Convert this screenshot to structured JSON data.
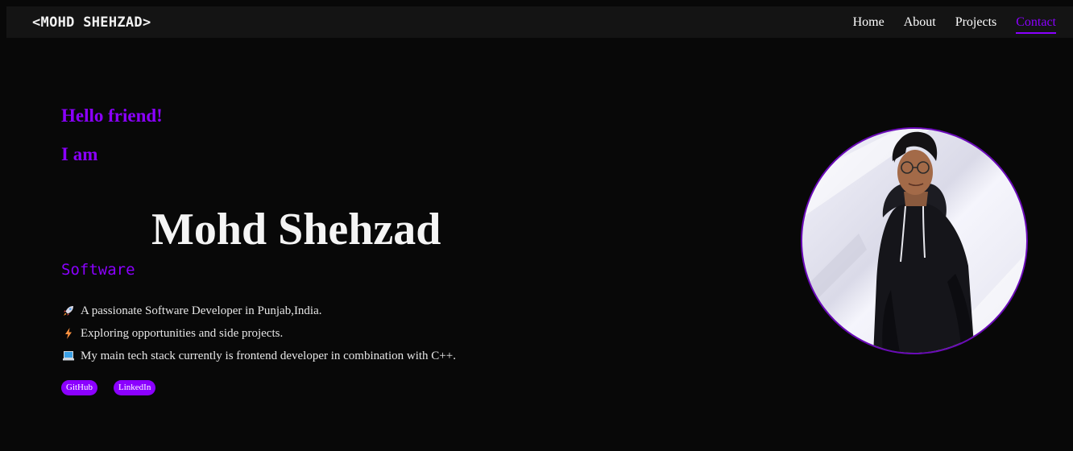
{
  "nav": {
    "logo": "<MOHD SHEHZAD>",
    "links": [
      "Home",
      "About",
      "Projects",
      "Contact"
    ],
    "active": "Contact"
  },
  "hero": {
    "greeting": "Hello friend!",
    "intro": "I am",
    "name": "Mohd Shehzad",
    "role": "Software",
    "bio": [
      {
        "icon": "rocket-icon",
        "text": "A passionate Software Developer in Punjab,India."
      },
      {
        "icon": "lightning-icon",
        "text": "Exploring opportunities and side projects."
      },
      {
        "icon": "laptop-icon",
        "text": "My main tech stack currently is frontend developer in combination with C++."
      }
    ],
    "socials": [
      "GitHub",
      "LinkedIn"
    ]
  },
  "colors": {
    "accent": "#8b00ff",
    "background": "#080808",
    "navbar": "#141414"
  }
}
